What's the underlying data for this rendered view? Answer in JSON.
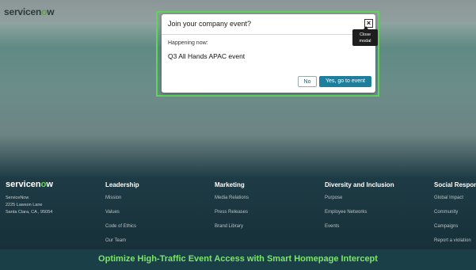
{
  "header": {
    "logo_prefix": "servicen",
    "logo_o": "o",
    "logo_suffix": "w"
  },
  "modal": {
    "title": "Join your company event?",
    "close_symbol": "×",
    "subtitle": "Happening now:",
    "event_name": "Q3 All Hands APAC event",
    "no_label": "No",
    "yes_label": "Yes, go to event",
    "tooltip_line1": "Close",
    "tooltip_line2": "modal"
  },
  "footer": {
    "logo_prefix": "servicen",
    "logo_o": "o",
    "logo_suffix": "w",
    "address_name": "ServiceNow",
    "address_street": "2225 Lawson Lane",
    "address_city": "Santa Clara, CA , 95054",
    "columns": [
      {
        "title": "Leadership",
        "links": [
          "Mission",
          "Values",
          "Code of Ethics",
          "Our Team"
        ]
      },
      {
        "title": "Marketing",
        "links": [
          "Media Relations",
          "Press Releases",
          "Brand Library"
        ]
      },
      {
        "title": "Diversity and Inclusion",
        "links": [
          "Purpose",
          "Employee Networks",
          "Events"
        ]
      },
      {
        "title": "Social Responsi",
        "links": [
          "Global Impact",
          "Community",
          "Campaigns",
          "Report a violation"
        ]
      }
    ]
  },
  "caption": "Optimize High-Traffic Event Access with Smart Homepage Intercept",
  "colors": {
    "accent_green": "#5fd35a",
    "primary_button": "#1f7e9b",
    "caption_text": "#7ce56b"
  }
}
